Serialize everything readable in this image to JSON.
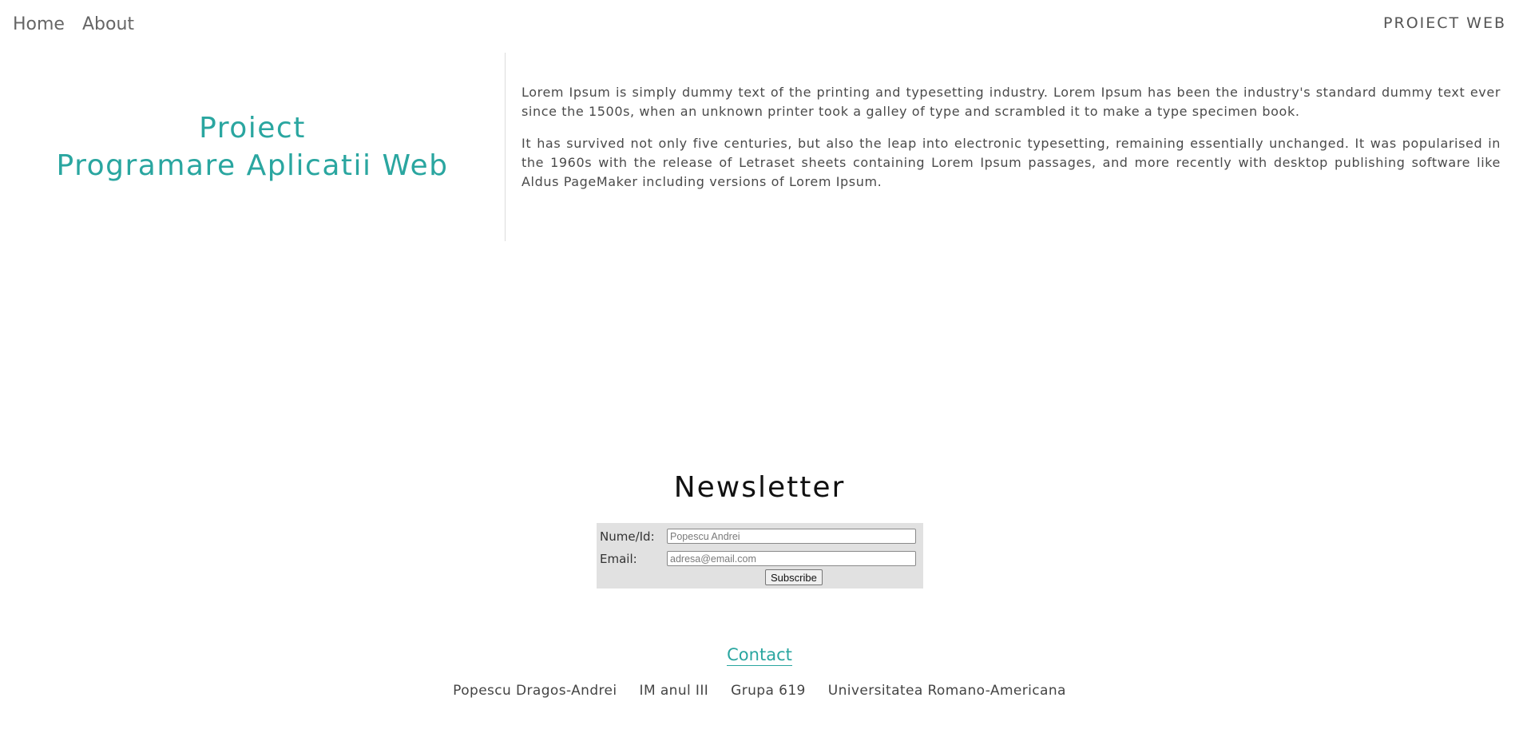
{
  "nav": {
    "items": [
      {
        "label": "Home"
      },
      {
        "label": "About"
      }
    ],
    "brand": "PROIECT WEB"
  },
  "hero": {
    "title_line1": "Proiect",
    "title_line2": "Programare Aplicatii Web",
    "paragraphs": [
      "Lorem Ipsum is simply dummy text of the printing and typesetting industry. Lorem Ipsum has been the industry's standard dummy text ever since the 1500s, when an unknown printer took a galley of type and scrambled it to make a type specimen book.",
      "It has survived not only five centuries, but also the leap into electronic typesetting, remaining essentially unchanged. It was popularised in the 1960s with the release of Letraset sheets containing Lorem Ipsum passages, and more recently with desktop publishing software like Aldus PageMaker including versions of Lorem Ipsum."
    ]
  },
  "newsletter": {
    "title": "Newsletter",
    "name_label": "Nume/Id:",
    "name_placeholder": "Popescu Andrei",
    "email_label": "Email:",
    "email_placeholder": "adresa@email.com",
    "submit_label": "Subscribe"
  },
  "contact": {
    "link_label": "Contact",
    "info": [
      "Popescu Dragos-Andrei",
      "IM anul III",
      "Grupa 619",
      "Universitatea Romano-Americana"
    ]
  },
  "colors": {
    "accent": "#2aa6a0",
    "form_background": "#e1e1e1"
  }
}
